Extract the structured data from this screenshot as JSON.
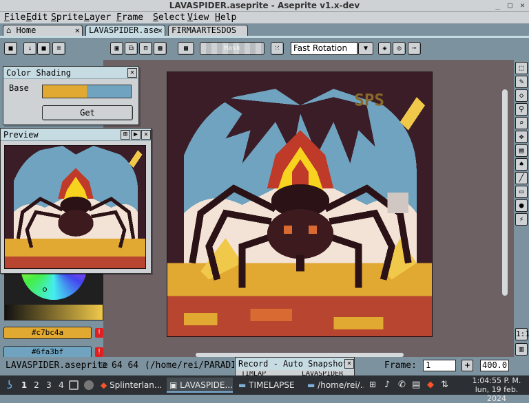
{
  "window": {
    "title": "LAVASPIDER.aseprite - Aseprite v1.x-dev",
    "min_glyph": "_",
    "max_glyph": "□",
    "close_glyph": "✕"
  },
  "menu": [
    "File",
    "Edit",
    "Sprite",
    "Layer",
    "Frame",
    "Select",
    "View",
    "Help"
  ],
  "tabs": [
    {
      "label": "Home",
      "close": "✕"
    },
    {
      "label": "LAVASPIDER.ase",
      "close": "✕"
    },
    {
      "label": "FIRMAARTESDOS",
      "close": ""
    }
  ],
  "toolbar": {
    "mask_label": "Mask",
    "rotation_value": "Fast Rotation",
    "rotation_arrow": "▼"
  },
  "color_shading": {
    "title": "Color Shading",
    "base_label": "Base",
    "get_label": "Get",
    "close": "✕",
    "colors": {
      "base_a": "#e1a832",
      "base_b": "#6fa3bf"
    }
  },
  "preview": {
    "title": "Preview",
    "btn_center": "⊞",
    "btn_play": "▶",
    "btn_close": "✕"
  },
  "color_bar": {
    "fg_hex": "#c7bc4a",
    "bg_hex": "#6fa3bf",
    "warn": "!"
  },
  "status": {
    "filename": "LAVASPIDER.aseprite",
    "size": "64 64",
    "path": "(/home/rei/PARADIBU",
    "frame_label": "Frame:",
    "frame_value": "1",
    "plus": "+",
    "zoom": "400.0"
  },
  "record": {
    "title": "Record - Auto Snapshot",
    "close": "✕",
    "sub_left": "TIMLAP",
    "sub_right": "LAVASPIDER"
  },
  "taskbar": {
    "workspaces": [
      "1",
      "2",
      "3",
      "4"
    ],
    "tasks": [
      {
        "label": "Splinterlan..."
      },
      {
        "label": "LAVASPIDE..."
      },
      {
        "label": "TIMELAPSE"
      },
      {
        "label": "/home/rei/..."
      }
    ],
    "time": "1:04:55 P. M.",
    "date": "lun, 19 feb. 2024"
  }
}
